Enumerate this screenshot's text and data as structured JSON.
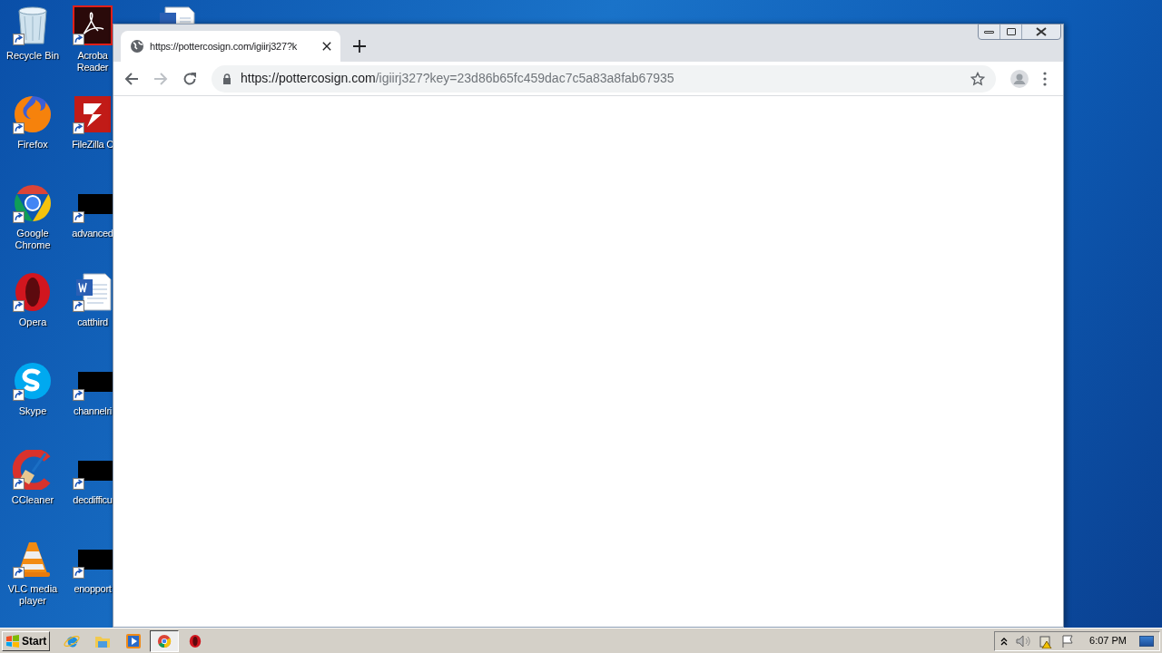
{
  "desktop": {
    "columns": [
      [
        {
          "kind": "recycle-bin",
          "label": "Recycle Bin"
        },
        {
          "kind": "firefox",
          "label": "Firefox"
        },
        {
          "kind": "chrome",
          "label": "Google Chrome"
        },
        {
          "kind": "opera",
          "label": "Opera"
        },
        {
          "kind": "skype",
          "label": "Skype"
        },
        {
          "kind": "ccleaner",
          "label": "CCleaner"
        },
        {
          "kind": "vlc",
          "label": "VLC media player"
        }
      ],
      [
        {
          "kind": "acrobat",
          "label": "Acroba Reader"
        },
        {
          "kind": "filezilla",
          "label": "FileZilla C"
        },
        {
          "kind": "thumbnail",
          "label": "advanced"
        },
        {
          "kind": "word",
          "label": "catthird"
        },
        {
          "kind": "thumbnail",
          "label": "channelri"
        },
        {
          "kind": "thumbnail",
          "label": "decdifficu"
        },
        {
          "kind": "thumbnail",
          "label": "enopport"
        }
      ],
      [
        {
          "kind": "document"
        }
      ]
    ]
  },
  "browser": {
    "tabs": [
      {
        "title": "https://pottercosign.com/igiirj327?k",
        "selected": true
      }
    ],
    "address_bar": {
      "host": "https://pottercosign.com",
      "path": "/igiirj327?key=23d86b65fc459dac7c5a83a8fab67935"
    }
  },
  "taskbar": {
    "start": "Start",
    "items": [
      {
        "kind": "ie",
        "selected": false
      },
      {
        "kind": "explorer",
        "selected": false
      },
      {
        "kind": "media",
        "selected": false
      },
      {
        "kind": "chrome",
        "selected": true
      },
      {
        "kind": "opera",
        "selected": false
      }
    ],
    "clock": "6:07 PM"
  }
}
